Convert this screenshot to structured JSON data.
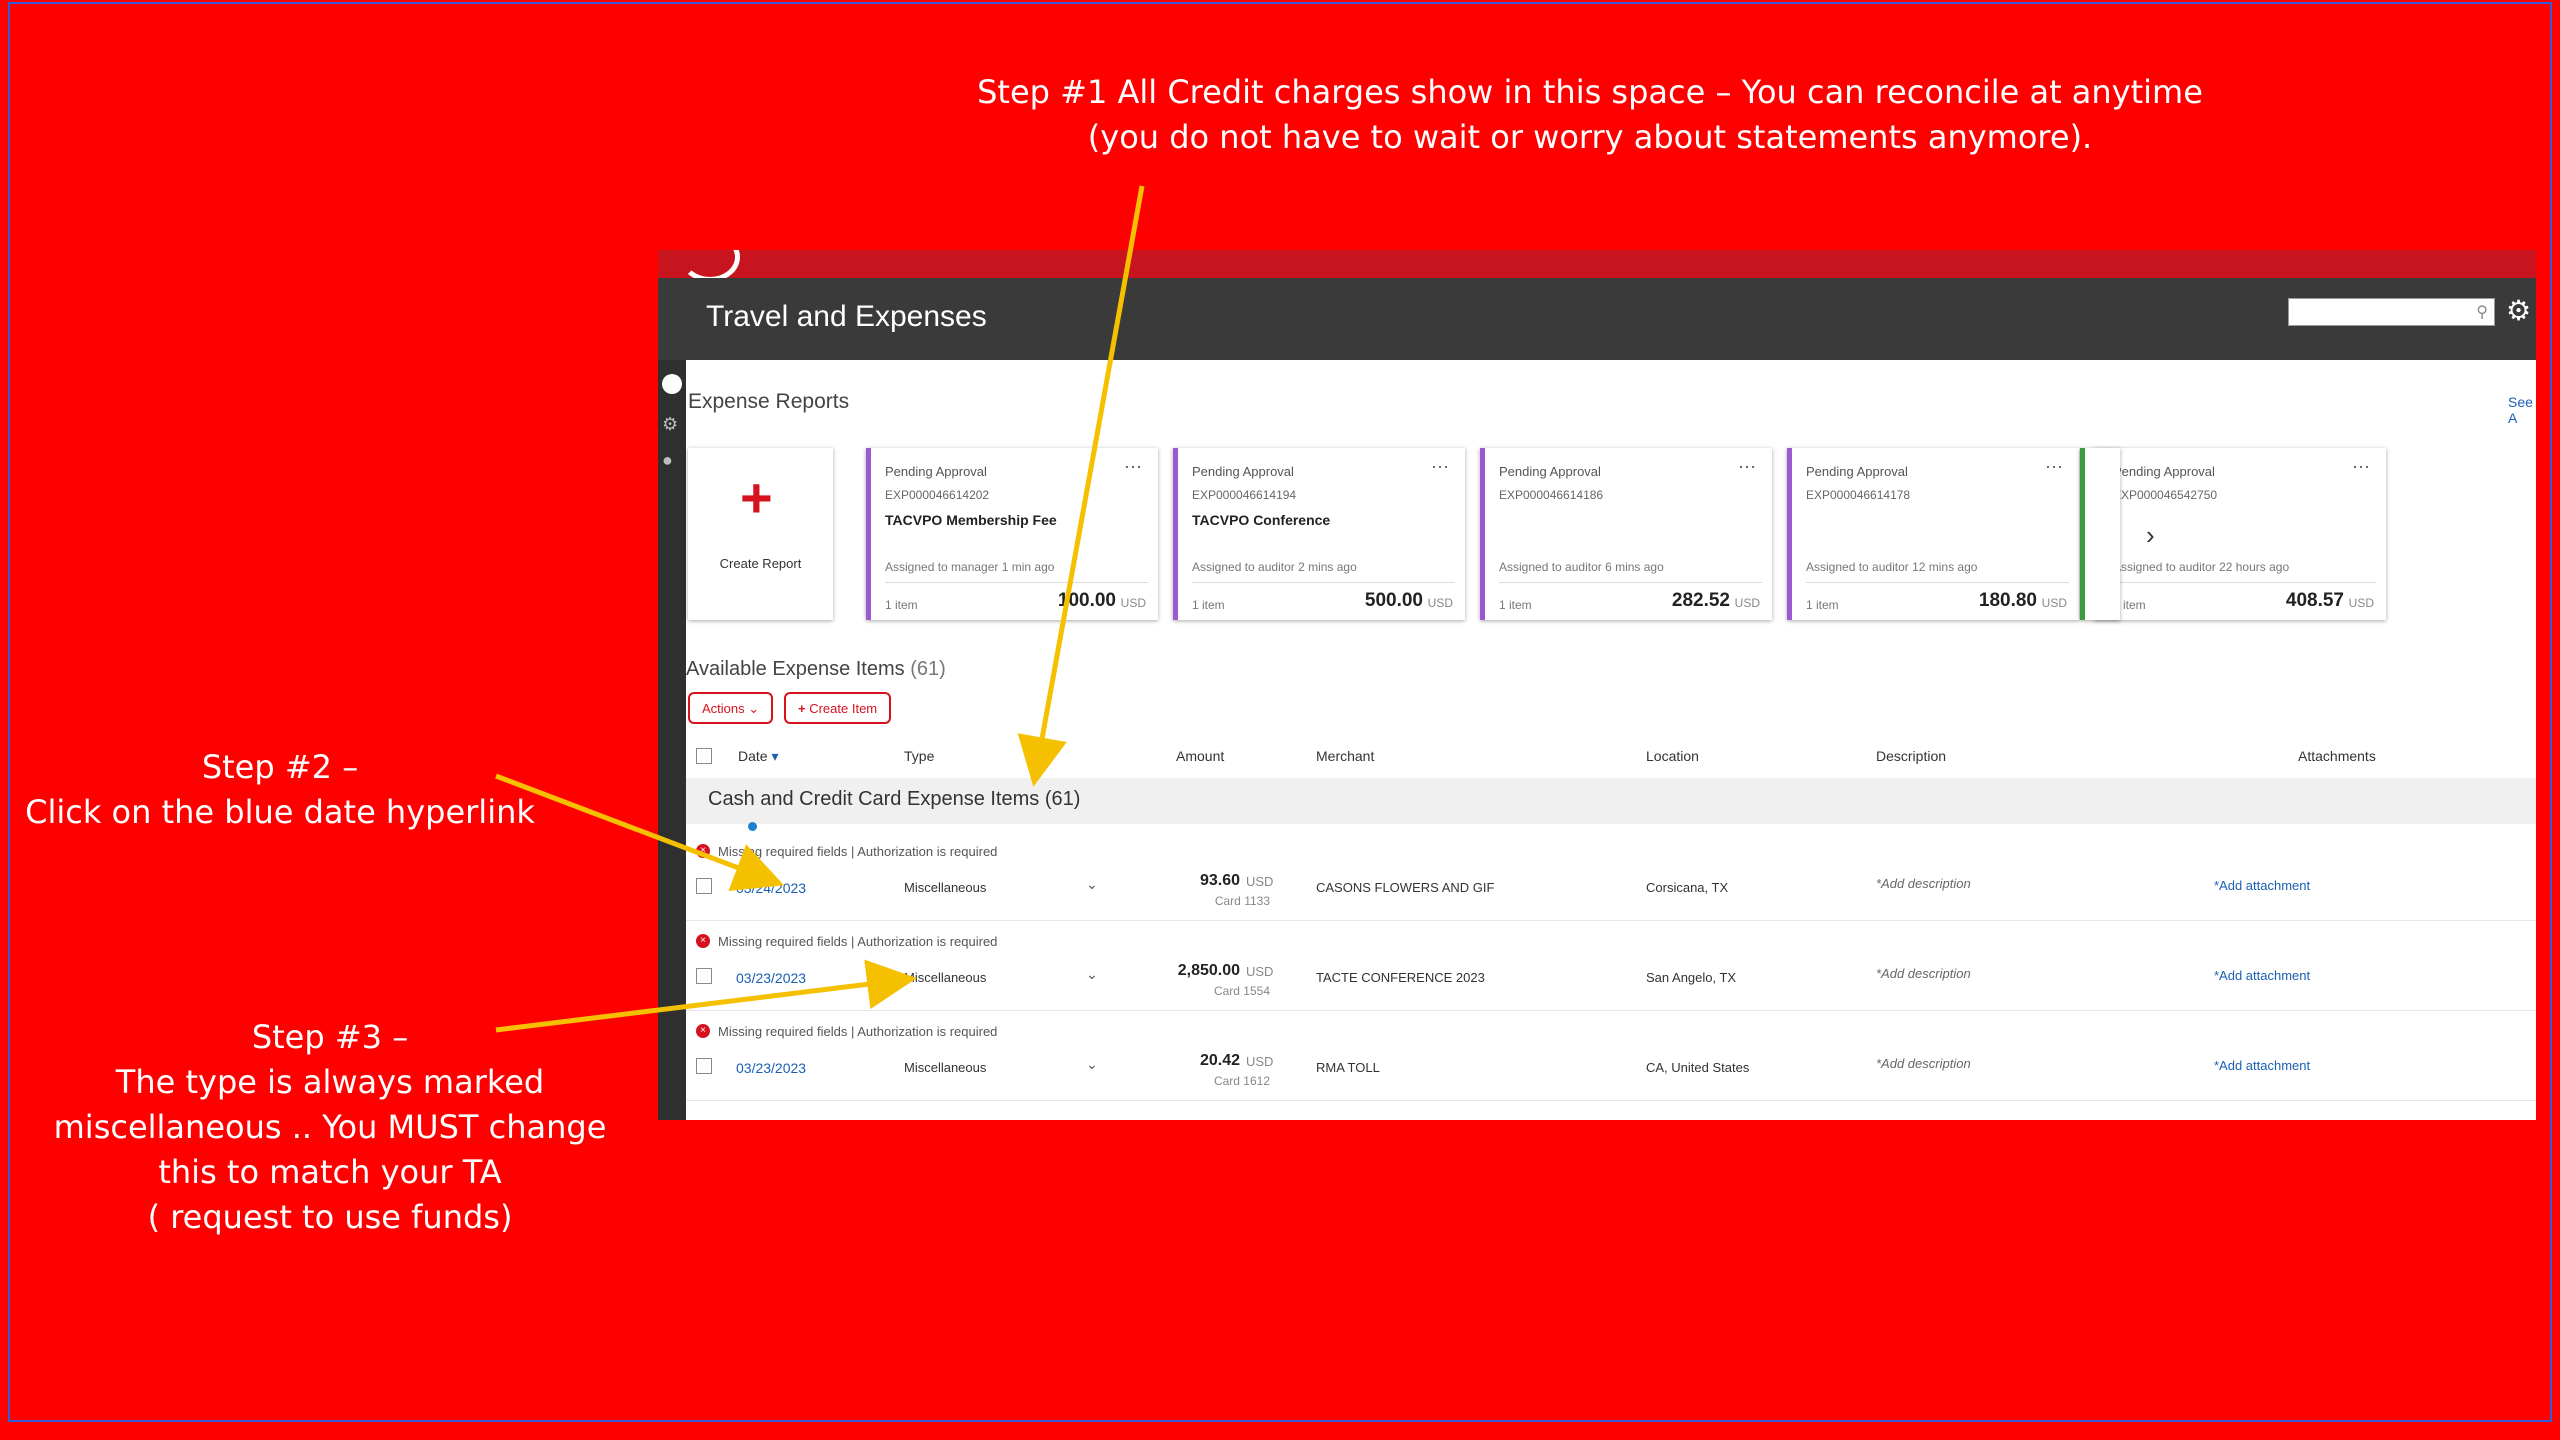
{
  "annotations": {
    "step1": [
      "Step #1 All Credit charges show in this space – You can reconcile at anytime",
      "(you do not have to wait or worry about statements anymore)."
    ],
    "step2": [
      "Step #2 –",
      "Click on the blue date hyperlink"
    ],
    "step3": [
      "Step #3 –",
      "The type is always marked",
      "miscellaneous .. You MUST change",
      "this to match your TA",
      "( request to use funds)"
    ]
  },
  "app": {
    "title": "Travel and Expenses",
    "expense_reports_title": "Expense Reports",
    "see_all": "See A",
    "create_report": "Create Report",
    "reports": [
      {
        "status": "Pending Approval",
        "id": "EXP000046614202",
        "name": "TACVPO Membership Fee",
        "assigned": "Assigned to manager 1 min ago",
        "items": "1 item",
        "amount": "100.00",
        "currency": "USD"
      },
      {
        "status": "Pending Approval",
        "id": "EXP000046614194",
        "name": "TACVPO Conference",
        "assigned": "Assigned to auditor 2 mins ago",
        "items": "1 item",
        "amount": "500.00",
        "currency": "USD"
      },
      {
        "status": "Pending Approval",
        "id": "EXP000046614186",
        "name": "",
        "assigned": "Assigned to auditor 6 mins ago",
        "items": "1 item",
        "amount": "282.52",
        "currency": "USD"
      },
      {
        "status": "Pending Approval",
        "id": "EXP000046614178",
        "name": "",
        "assigned": "Assigned to auditor 12 mins ago",
        "items": "1 item",
        "amount": "180.80",
        "currency": "USD"
      },
      {
        "status": "Pending Approval",
        "id": "EXP000046542750",
        "name": "",
        "assigned": "Assigned to auditor 22 hours ago",
        "items": "1 item",
        "amount": "408.57",
        "currency": "USD"
      }
    ],
    "available_title": "Available Expense Items",
    "available_count": "(61)",
    "actions_label": "Actions",
    "create_item_label": "Create Item",
    "columns": {
      "date": "Date",
      "type": "Type",
      "amount": "Amount",
      "merchant": "Merchant",
      "location": "Location",
      "description": "Description",
      "attachments": "Attachments"
    },
    "group_label": "Cash and Credit Card Expense Items (61)",
    "rows": [
      {
        "warning": "Missing required fields | Authorization is required",
        "date": "03/24/2023",
        "type": "Miscellaneous",
        "amount": "93.60",
        "currency": "USD",
        "card": "Card 1133",
        "merchant": "CASONS FLOWERS AND GIF",
        "location": "Corsicana, TX",
        "description": "*Add description",
        "attachment": "*Add attachment"
      },
      {
        "warning": "Missing required fields | Authorization is required",
        "date": "03/23/2023",
        "type": "Miscellaneous",
        "amount": "2,850.00",
        "currency": "USD",
        "card": "Card 1554",
        "merchant": "TACTE CONFERENCE 2023",
        "location": "San Angelo, TX",
        "description": "*Add description",
        "attachment": "*Add attachment"
      },
      {
        "warning": "Missing required fields | Authorization is required",
        "date": "03/23/2023",
        "type": "Miscellaneous",
        "amount": "20.42",
        "currency": "USD",
        "card": "Card 1612",
        "merchant": "RMA TOLL",
        "location": "CA, United States",
        "description": "*Add description",
        "attachment": "*Add attachment"
      }
    ]
  },
  "colors": {
    "slide_background": "#ff0000",
    "arrow": "#f5c000",
    "brand": "#c8141e",
    "link": "#1a5fb4"
  }
}
